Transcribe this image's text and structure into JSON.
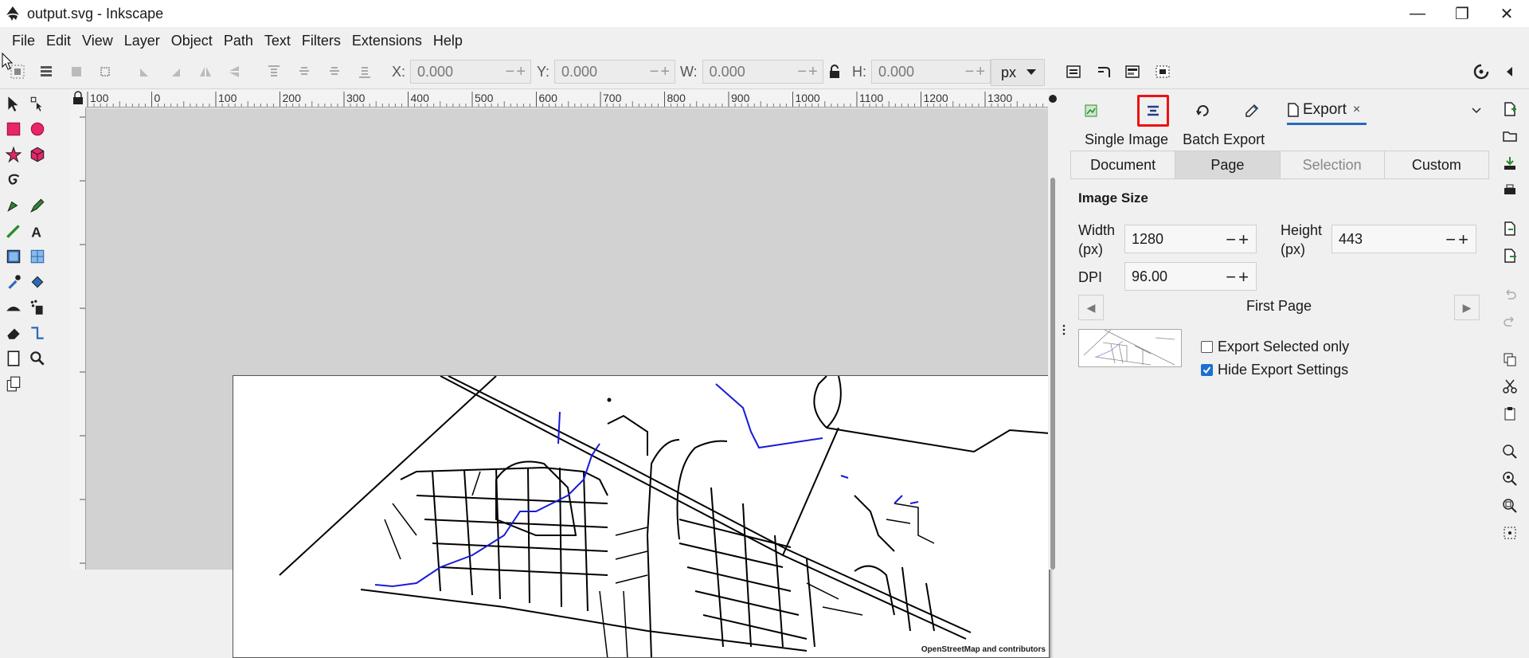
{
  "window": {
    "title": "output.svg - Inkscape",
    "minimize_icon": "minimize-icon",
    "restore_icon": "restore-icon",
    "close_icon": "close-icon"
  },
  "menu": [
    "File",
    "Edit",
    "View",
    "Layer",
    "Object",
    "Path",
    "Text",
    "Filters",
    "Extensions",
    "Help"
  ],
  "toolbar": {
    "x_label": "X:",
    "x_value": "0.000",
    "y_label": "Y:",
    "y_value": "0.000",
    "w_label": "W:",
    "w_value": "0.000",
    "h_label": "H:",
    "h_value": "0.000",
    "unit": "px"
  },
  "rulers": {
    "top_ticks": [
      "100",
      "0",
      "100",
      "200",
      "300",
      "400",
      "500",
      "600",
      "700",
      "800",
      "900",
      "1000",
      "1100",
      "1200",
      "1300"
    ]
  },
  "canvas": {
    "credit": "OpenStreetMap and contributors"
  },
  "panel": {
    "export_tab": "Export",
    "export_tab_close": "×",
    "subtabs": [
      "Single Image",
      "Batch Export"
    ],
    "areas": [
      "Document",
      "Page",
      "Selection",
      "Custom"
    ],
    "active_area": "Page",
    "section_title": "Image Size",
    "width_label": "Width (px)",
    "width_value": "1280",
    "height_label": "Height (px)",
    "height_value": "443",
    "dpi_label": "DPI",
    "dpi_value": "96.00",
    "page_nav_label": "First Page",
    "export_selected_label": "Export Selected only",
    "export_selected_checked": false,
    "hide_settings_label": "Hide Export Settings",
    "hide_settings_checked": true
  },
  "colors": {
    "accent": "#2a6ab8",
    "highlight": "#e11111",
    "water": "#1a1ad8"
  }
}
